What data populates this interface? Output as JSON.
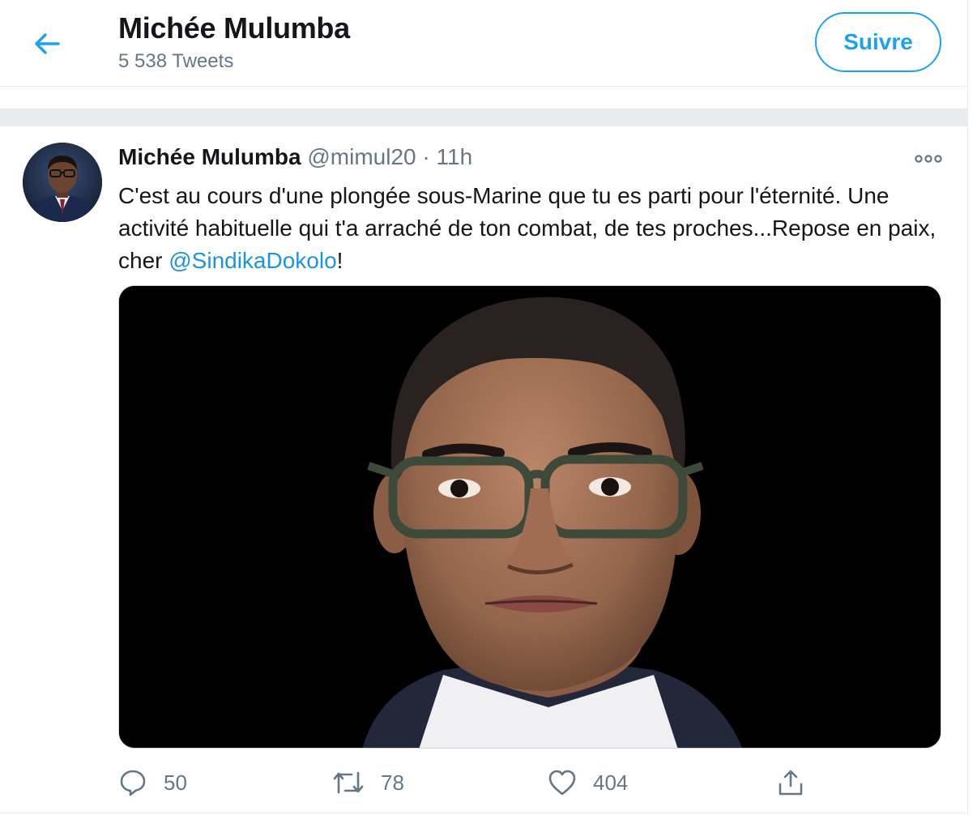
{
  "header": {
    "back_label": "Back",
    "profile_name": "Michée Mulumba",
    "tweet_count": "5 538 Tweets",
    "follow_label": "Suivre"
  },
  "tweet": {
    "author_name": "Michée Mulumba",
    "handle": "@mimul20",
    "separator": "·",
    "time": "11h",
    "text_before_mention": "C'est au cours d'une plongée sous-Marine que tu es parti pour l'éternité. Une activité habituelle qui t'a arraché de ton combat, de tes proches...Repose en paix, cher ",
    "mention": "@SindikaDokolo",
    "text_after_mention": "!",
    "media_icon": "photo-portrait",
    "actions": {
      "reply": {
        "icon": "reply-icon",
        "count": "50"
      },
      "retweet": {
        "icon": "retweet-icon",
        "count": "78"
      },
      "like": {
        "icon": "heart-icon",
        "count": "404"
      },
      "share": {
        "icon": "share-icon"
      }
    }
  },
  "colors": {
    "accent": "#1da1f2",
    "link": "#1b95e0",
    "secondary_text": "#657786",
    "divider": "#e6ecf0"
  }
}
